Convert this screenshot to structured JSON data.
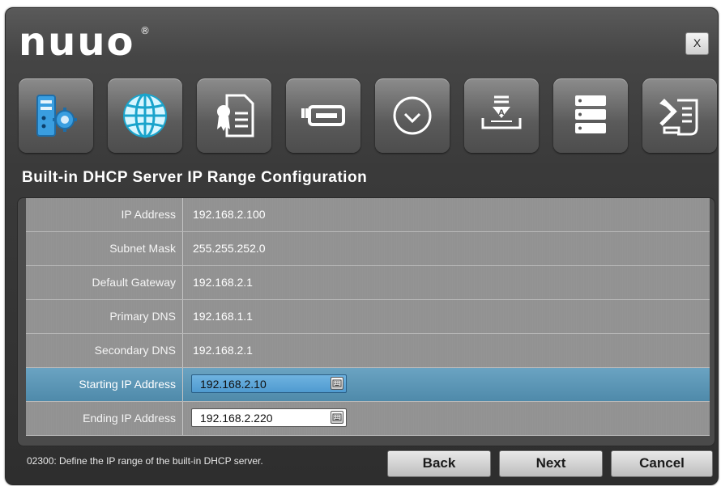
{
  "app": {
    "logo_text": "nuuo",
    "logo_mark": "®",
    "close_label": "X"
  },
  "toolbar": {
    "items": [
      {
        "icon": "server-settings-icon"
      },
      {
        "icon": "globe-network-icon"
      },
      {
        "icon": "license-certificate-icon"
      },
      {
        "icon": "storage-drive-icon"
      },
      {
        "icon": "clock-icon"
      },
      {
        "icon": "install-download-icon"
      },
      {
        "icon": "server-rack-icon"
      },
      {
        "icon": "tools-scroll-icon"
      }
    ]
  },
  "section": {
    "title": "Built-in DHCP Server IP Range Configuration"
  },
  "rows": [
    {
      "label": "IP Address",
      "value": "192.168.2.100"
    },
    {
      "label": "Subnet Mask",
      "value": "255.255.252.0"
    },
    {
      "label": "Default Gateway",
      "value": "192.168.2.1"
    },
    {
      "label": "Primary DNS",
      "value": "192.168.1.1"
    },
    {
      "label": "Secondary DNS",
      "value": "192.168.2.1"
    }
  ],
  "inputs": {
    "start": {
      "label": "Starting IP Address",
      "value": "192.168.2.10"
    },
    "end": {
      "label": "Ending IP Address",
      "value": "192.168.2.220"
    }
  },
  "status_text": "02300: Define the IP range of the built-in DHCP server.",
  "buttons": {
    "back": "Back",
    "next": "Next",
    "cancel": "Cancel"
  },
  "colors": {
    "selected_row": "#5a95b5",
    "accent_field": "#5fa6dc"
  }
}
